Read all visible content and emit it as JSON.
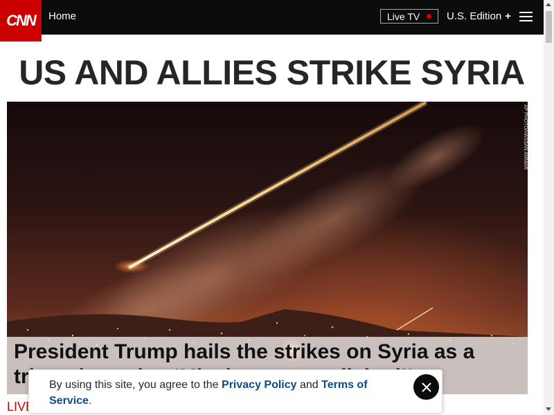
{
  "nav": {
    "logo": "CNN",
    "home": "Home",
    "live_tv": "Live TV",
    "edition": "U.S. Edition",
    "edition_plus": "+"
  },
  "headline": "US AND ALLIES STRIKE SYRIA",
  "hero": {
    "photo_credit": "AP PHOTO/HASSAN AMMAR",
    "caption": "President Trump hails the strikes on Syria as a triumph, saying 'Mission accomplished!'"
  },
  "live_label": "LIVE",
  "cookie": {
    "text_before": "By using this site, you agree to the ",
    "privacy_link": "Privacy Policy",
    "text_and": " and ",
    "terms_link": "Terms of Service",
    "text_after": "."
  },
  "colors": {
    "brand_red": "#cc0000",
    "nav_bg": "#0c0c0c",
    "link_blue": "#0c4a8a"
  }
}
